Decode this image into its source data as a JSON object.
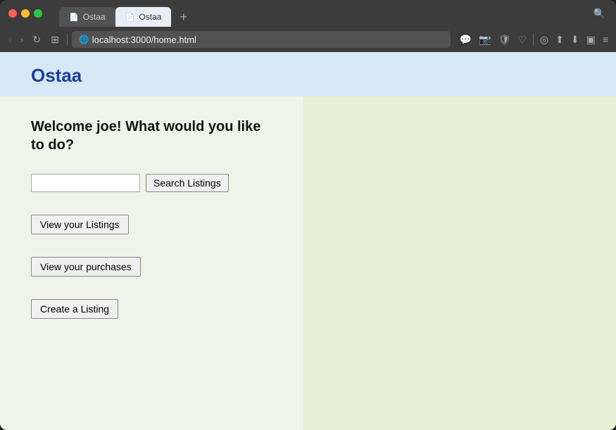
{
  "browser": {
    "tabs": [
      {
        "label": "Ostaa",
        "active": false,
        "icon": "📄"
      },
      {
        "label": "Ostaa",
        "active": true,
        "icon": "📄"
      }
    ],
    "url": "localhost:3000/home.html",
    "new_tab_label": "+",
    "search_icon": "🔍"
  },
  "header": {
    "app_title": "Ostaa"
  },
  "main": {
    "welcome_text": "Welcome joe! What would you like to do?",
    "search": {
      "placeholder": "",
      "button_label": "Search Listings"
    },
    "buttons": {
      "view_listings": "View your Listings",
      "view_purchases": "View your purchases",
      "create_listing": "Create a Listing"
    }
  }
}
